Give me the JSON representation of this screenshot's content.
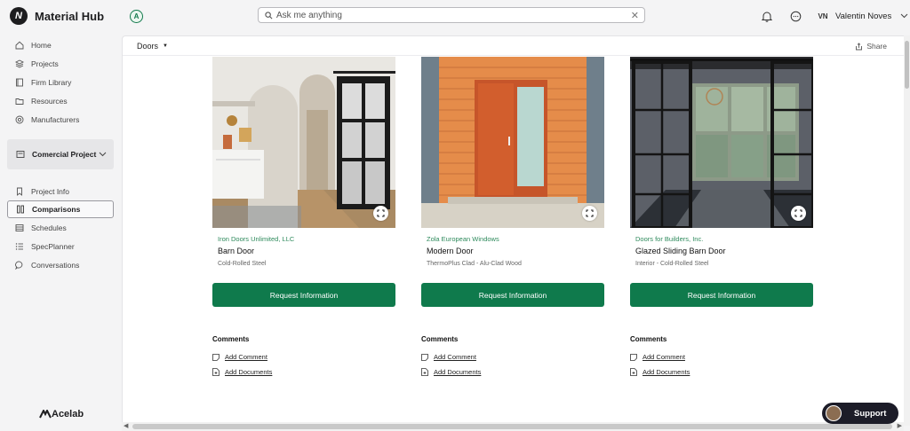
{
  "app": {
    "name": "Material Hub",
    "logo_icon": "material-hub-logo"
  },
  "search": {
    "placeholder": "Ask me anything"
  },
  "user": {
    "initials": "VN",
    "name": "Valentin Noves"
  },
  "sidebar": {
    "top_items": [
      {
        "label": "Home",
        "icon": "home-icon"
      },
      {
        "label": "Projects",
        "icon": "layers-icon"
      },
      {
        "label": "Firm Library",
        "icon": "book-icon"
      },
      {
        "label": "Resources",
        "icon": "folder-icon"
      },
      {
        "label": "Manufacturers",
        "icon": "target-icon"
      }
    ],
    "project": {
      "label": "Comercial Project"
    },
    "project_items": [
      {
        "label": "Project Info",
        "icon": "bookmark-icon"
      },
      {
        "label": "Comparisons",
        "icon": "columns-icon",
        "active": true
      },
      {
        "label": "Schedules",
        "icon": "list-icon"
      },
      {
        "label": "SpecPlanner",
        "icon": "bullet-list-icon"
      },
      {
        "label": "Conversations",
        "icon": "chat-icon"
      }
    ],
    "footer_brand": "Acelab"
  },
  "main": {
    "breadcrumb": "Doors",
    "share_label": "Share",
    "request_label": "Request Information",
    "comments_heading": "Comments",
    "add_comment_label": "Add Comment",
    "add_documents_label": "Add Documents",
    "products": [
      {
        "manufacturer": "Iron Doors Unlimited, LLC",
        "name": "Barn Door",
        "description": "Cold-Rolled Steel"
      },
      {
        "manufacturer": "Zola European Windows",
        "name": "Modern Door",
        "description": "ThermoPlus Clad - Alu-Clad Wood"
      },
      {
        "manufacturer": "Doors for Builders, Inc.",
        "name": "Glazed Sliding Barn Door",
        "description": "Interior - Cold-Rolled Steel"
      }
    ]
  },
  "support": {
    "label": "Support"
  },
  "colors": {
    "brand_green": "#0f7a4c",
    "manufacturer_green": "#2e8a5c",
    "support_bg": "#1c1c28"
  }
}
